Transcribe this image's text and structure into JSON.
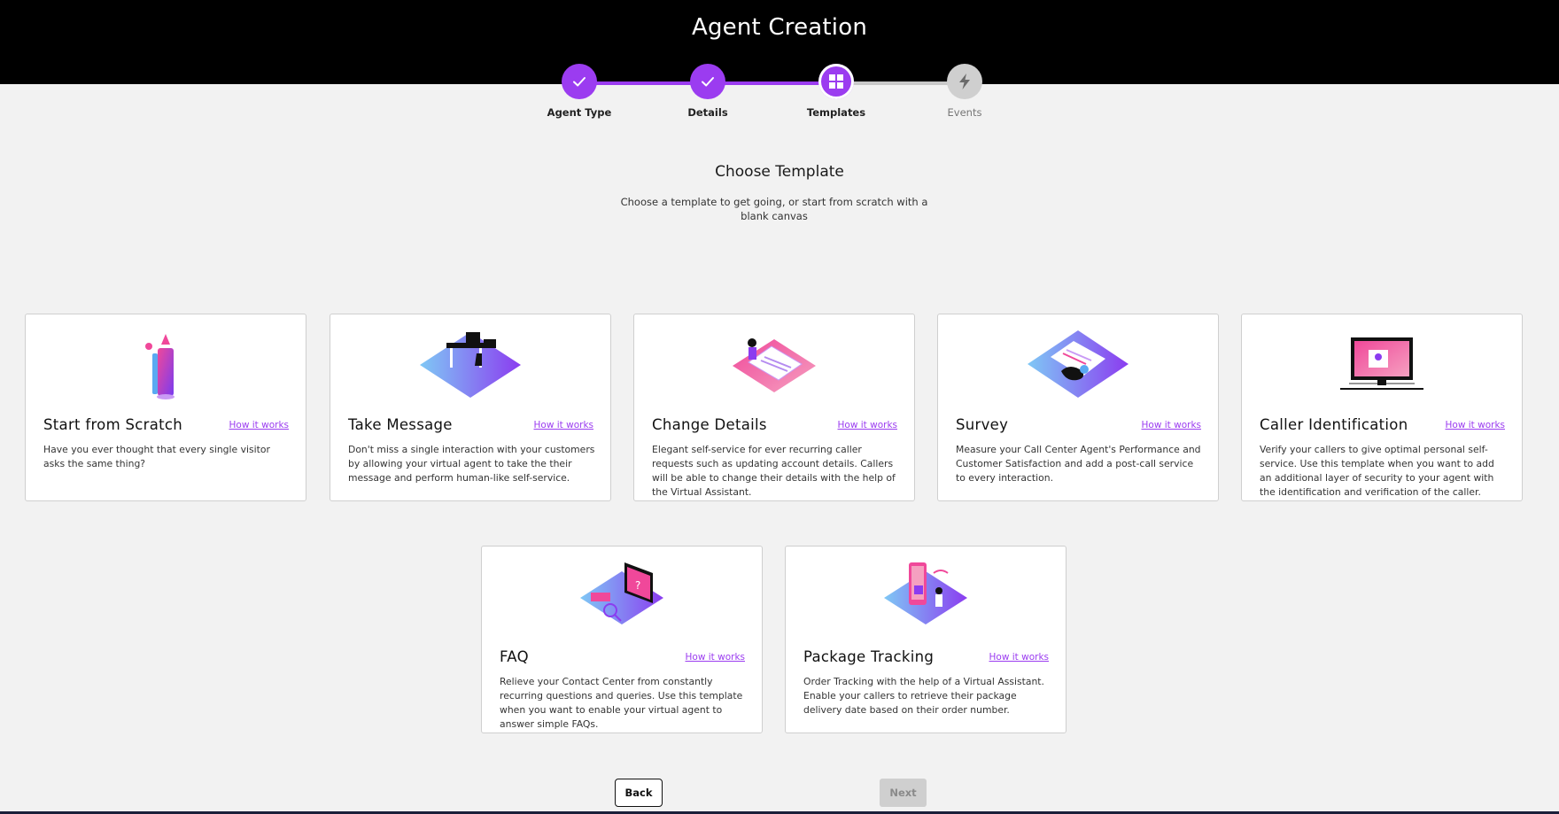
{
  "header": {
    "title": "Agent Creation"
  },
  "stepper": {
    "steps": [
      {
        "label": "Agent Type",
        "state": "done"
      },
      {
        "label": "Details",
        "state": "done"
      },
      {
        "label": "Templates",
        "state": "active"
      },
      {
        "label": "Events",
        "state": "future"
      }
    ]
  },
  "main": {
    "title": "Choose Template",
    "subtitle": "Choose a template to get going, or start from scratch with a blank canvas"
  },
  "templates": [
    {
      "title": "Start from Scratch",
      "link": "How it works",
      "desc": "Have you ever thought that every single visitor asks the same thing?",
      "icon": "pencil-illustration"
    },
    {
      "title": "Take Message",
      "link": "How it works",
      "desc": "Don't miss a single interaction with your customers by allowing your virtual agent to take the their message and perform human-like self-service.",
      "icon": "desk-illustration"
    },
    {
      "title": "Change Details",
      "link": "How it works",
      "desc": "Elegant self-service for ever recurring caller requests such as updating account details. Callers will be able to change their details with the help of the Virtual Assistant.",
      "icon": "document-illustration"
    },
    {
      "title": "Survey",
      "link": "How it works",
      "desc": "Measure your Call Center Agent's Performance and Customer Satisfaction and add a post-call service to every interaction.",
      "icon": "headset-illustration"
    },
    {
      "title": "Caller Identification",
      "link": "How it works",
      "desc": "Verify your callers to give optimal personal self-service. Use this template when you want to add an additional layer of security to your agent with the identification and verification of the caller.",
      "icon": "monitor-illustration"
    },
    {
      "title": "FAQ",
      "link": "How it works",
      "desc": "Relieve your Contact Center from constantly recurring questions and queries. Use this template when you want to enable your virtual agent to answer simple FAQs.",
      "icon": "laptop-illustration"
    },
    {
      "title": "Package Tracking",
      "link": "How it works",
      "desc": "Order Tracking with the help of a Virtual Assistant. Enable your callers to retrieve their package delivery date based on their order number.",
      "icon": "phone-package-illustration"
    }
  ],
  "footer": {
    "back_label": "Back",
    "next_label": "Next"
  },
  "colors": {
    "accent": "#9b3cf0",
    "header_bg": "#000000",
    "page_bg": "#f2f2f2",
    "inactive": "#cfcfcf"
  }
}
